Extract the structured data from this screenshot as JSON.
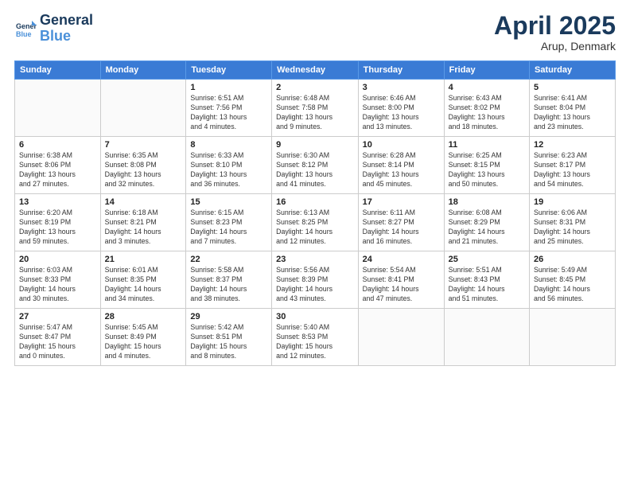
{
  "header": {
    "logo_line1": "General",
    "logo_line2": "Blue",
    "month": "April 2025",
    "location": "Arup, Denmark"
  },
  "days_of_week": [
    "Sunday",
    "Monday",
    "Tuesday",
    "Wednesday",
    "Thursday",
    "Friday",
    "Saturday"
  ],
  "weeks": [
    [
      {
        "day": "",
        "info": ""
      },
      {
        "day": "",
        "info": ""
      },
      {
        "day": "1",
        "info": "Sunrise: 6:51 AM\nSunset: 7:56 PM\nDaylight: 13 hours\nand 4 minutes."
      },
      {
        "day": "2",
        "info": "Sunrise: 6:48 AM\nSunset: 7:58 PM\nDaylight: 13 hours\nand 9 minutes."
      },
      {
        "day": "3",
        "info": "Sunrise: 6:46 AM\nSunset: 8:00 PM\nDaylight: 13 hours\nand 13 minutes."
      },
      {
        "day": "4",
        "info": "Sunrise: 6:43 AM\nSunset: 8:02 PM\nDaylight: 13 hours\nand 18 minutes."
      },
      {
        "day": "5",
        "info": "Sunrise: 6:41 AM\nSunset: 8:04 PM\nDaylight: 13 hours\nand 23 minutes."
      }
    ],
    [
      {
        "day": "6",
        "info": "Sunrise: 6:38 AM\nSunset: 8:06 PM\nDaylight: 13 hours\nand 27 minutes."
      },
      {
        "day": "7",
        "info": "Sunrise: 6:35 AM\nSunset: 8:08 PM\nDaylight: 13 hours\nand 32 minutes."
      },
      {
        "day": "8",
        "info": "Sunrise: 6:33 AM\nSunset: 8:10 PM\nDaylight: 13 hours\nand 36 minutes."
      },
      {
        "day": "9",
        "info": "Sunrise: 6:30 AM\nSunset: 8:12 PM\nDaylight: 13 hours\nand 41 minutes."
      },
      {
        "day": "10",
        "info": "Sunrise: 6:28 AM\nSunset: 8:14 PM\nDaylight: 13 hours\nand 45 minutes."
      },
      {
        "day": "11",
        "info": "Sunrise: 6:25 AM\nSunset: 8:15 PM\nDaylight: 13 hours\nand 50 minutes."
      },
      {
        "day": "12",
        "info": "Sunrise: 6:23 AM\nSunset: 8:17 PM\nDaylight: 13 hours\nand 54 minutes."
      }
    ],
    [
      {
        "day": "13",
        "info": "Sunrise: 6:20 AM\nSunset: 8:19 PM\nDaylight: 13 hours\nand 59 minutes."
      },
      {
        "day": "14",
        "info": "Sunrise: 6:18 AM\nSunset: 8:21 PM\nDaylight: 14 hours\nand 3 minutes."
      },
      {
        "day": "15",
        "info": "Sunrise: 6:15 AM\nSunset: 8:23 PM\nDaylight: 14 hours\nand 7 minutes."
      },
      {
        "day": "16",
        "info": "Sunrise: 6:13 AM\nSunset: 8:25 PM\nDaylight: 14 hours\nand 12 minutes."
      },
      {
        "day": "17",
        "info": "Sunrise: 6:11 AM\nSunset: 8:27 PM\nDaylight: 14 hours\nand 16 minutes."
      },
      {
        "day": "18",
        "info": "Sunrise: 6:08 AM\nSunset: 8:29 PM\nDaylight: 14 hours\nand 21 minutes."
      },
      {
        "day": "19",
        "info": "Sunrise: 6:06 AM\nSunset: 8:31 PM\nDaylight: 14 hours\nand 25 minutes."
      }
    ],
    [
      {
        "day": "20",
        "info": "Sunrise: 6:03 AM\nSunset: 8:33 PM\nDaylight: 14 hours\nand 30 minutes."
      },
      {
        "day": "21",
        "info": "Sunrise: 6:01 AM\nSunset: 8:35 PM\nDaylight: 14 hours\nand 34 minutes."
      },
      {
        "day": "22",
        "info": "Sunrise: 5:58 AM\nSunset: 8:37 PM\nDaylight: 14 hours\nand 38 minutes."
      },
      {
        "day": "23",
        "info": "Sunrise: 5:56 AM\nSunset: 8:39 PM\nDaylight: 14 hours\nand 43 minutes."
      },
      {
        "day": "24",
        "info": "Sunrise: 5:54 AM\nSunset: 8:41 PM\nDaylight: 14 hours\nand 47 minutes."
      },
      {
        "day": "25",
        "info": "Sunrise: 5:51 AM\nSunset: 8:43 PM\nDaylight: 14 hours\nand 51 minutes."
      },
      {
        "day": "26",
        "info": "Sunrise: 5:49 AM\nSunset: 8:45 PM\nDaylight: 14 hours\nand 56 minutes."
      }
    ],
    [
      {
        "day": "27",
        "info": "Sunrise: 5:47 AM\nSunset: 8:47 PM\nDaylight: 15 hours\nand 0 minutes."
      },
      {
        "day": "28",
        "info": "Sunrise: 5:45 AM\nSunset: 8:49 PM\nDaylight: 15 hours\nand 4 minutes."
      },
      {
        "day": "29",
        "info": "Sunrise: 5:42 AM\nSunset: 8:51 PM\nDaylight: 15 hours\nand 8 minutes."
      },
      {
        "day": "30",
        "info": "Sunrise: 5:40 AM\nSunset: 8:53 PM\nDaylight: 15 hours\nand 12 minutes."
      },
      {
        "day": "",
        "info": ""
      },
      {
        "day": "",
        "info": ""
      },
      {
        "day": "",
        "info": ""
      }
    ]
  ]
}
